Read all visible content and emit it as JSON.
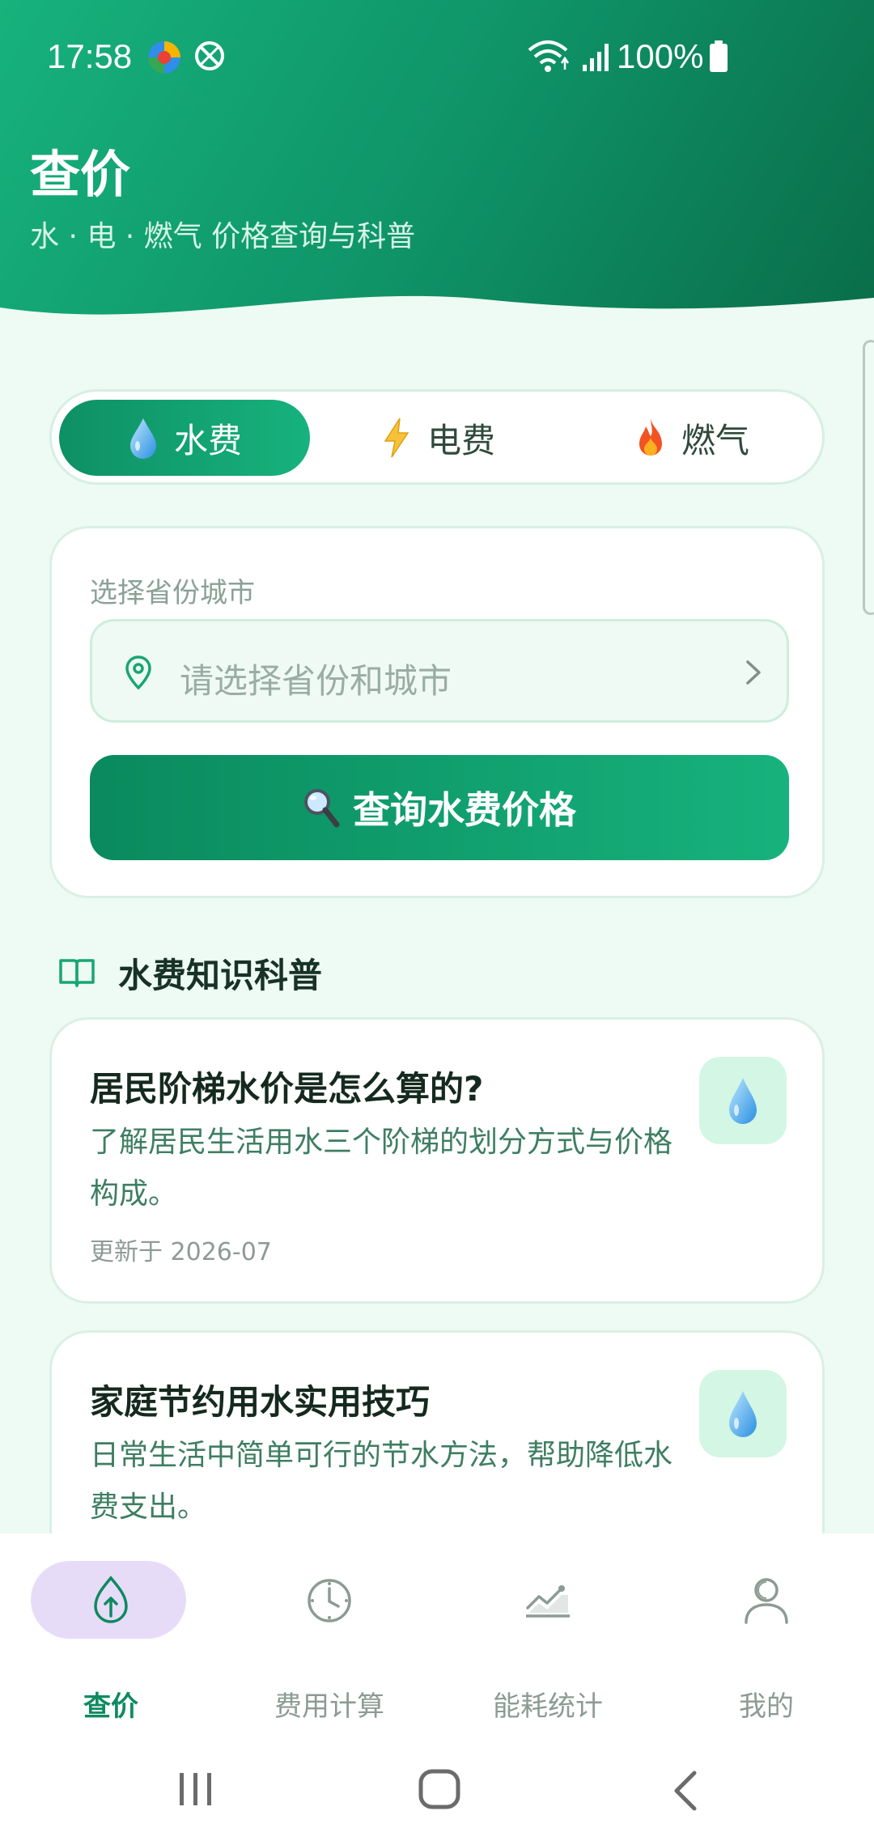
{
  "status_bar": {
    "time": "17:58",
    "battery": "100%"
  },
  "header": {
    "title": "查价",
    "subtitle": "水 · 电 · 燃气 价格查询与科普"
  },
  "tabs": [
    {
      "label": "水费",
      "icon": "water-drop-icon",
      "active": true
    },
    {
      "label": "电费",
      "icon": "lightning-icon",
      "active": false
    },
    {
      "label": "燃气",
      "icon": "fire-icon",
      "active": false
    }
  ],
  "query": {
    "field_label": "选择省份城市",
    "placeholder": "请选择省份和城市",
    "button_label": "查询水费价格"
  },
  "section": {
    "title": "水费知识科普"
  },
  "articles": [
    {
      "title": "居民阶梯水价是怎么算的?",
      "desc": "了解居民生活用水三个阶梯的划分方式与价格构成。",
      "date": "更新于 2026-07"
    },
    {
      "title": "家庭节约用水实用技巧",
      "desc": "日常生活中简单可行的节水方法，帮助降低水费支出。"
    }
  ],
  "bottom_nav": [
    {
      "label": "查价",
      "icon": "price-leaf-icon",
      "active": true
    },
    {
      "label": "费用计算",
      "icon": "clock-icon",
      "active": false
    },
    {
      "label": "能耗统计",
      "icon": "chart-icon",
      "active": false
    },
    {
      "label": "我的",
      "icon": "user-icon",
      "active": false
    }
  ],
  "colors": {
    "primary": "#0e9064",
    "primary_light": "#17b27d",
    "background": "#eefaf4",
    "nav_pill": "#e7dcf8"
  }
}
